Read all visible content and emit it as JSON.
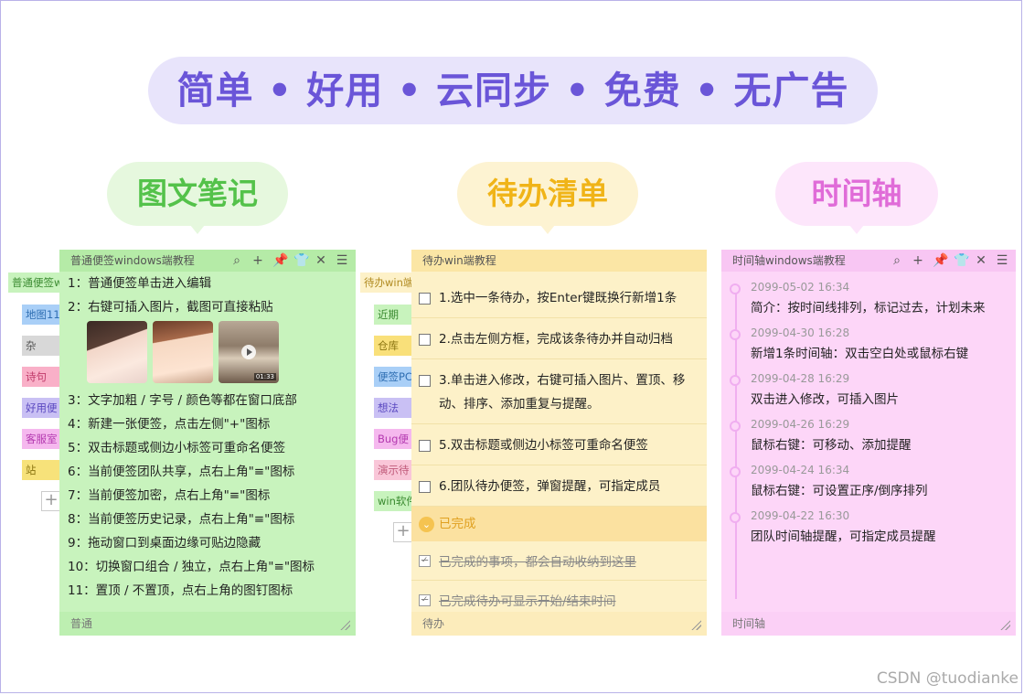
{
  "headline": "简单 • 好用 • 云同步 • 免费 • 无广告",
  "pills": {
    "green": "图文笔记",
    "yellow": "待办清单",
    "pink": "时间轴"
  },
  "green_panel": {
    "title": "普通便签windows端教程",
    "footer": "普通",
    "lines": [
      "1：普通便签单击进入编辑",
      "2：右键可插入图片，截图可直接粘贴",
      "3：文字加粗 / 字号 / 颜色等都在窗口底部",
      "4：新建一张便签，点击左侧\"+\"图标",
      "5：双击标题或侧边小标签可重命名便签",
      "6：当前便签团队共享，点右上角\"≡\"图标",
      "7：当前便签加密，点右上角\"≡\"图标",
      "8：当前便签历史记录，点右上角\"≡\"图标",
      "9：拖动窗口到桌面边缘可贴边隐藏",
      "10：切换窗口组合 / 独立，点右上角\"≡\"图标",
      "11：置顶 / 不置顶，点右上角的图钉图标"
    ],
    "video_duration": "01:33"
  },
  "green_tabs": [
    "普通便签w",
    "地图11",
    "杂",
    "诗句",
    "好用便",
    "客服室",
    "站"
  ],
  "yellow_panel": {
    "title": "待办win端教程",
    "footer": "待办",
    "todos": [
      "1.选中一条待办，按Enter键既换行新增1条",
      "2.点击左侧方框，完成该条待办并自动归档",
      "3.单击进入修改，右键可插入图片、置顶、移动、排序、添加重复与提醒。",
      "5.双击标题或侧边小标签可重命名便签",
      "6.团队待办便签，弹窗提醒，可指定成员"
    ],
    "done_label": "已完成",
    "done_items": [
      "已完成的事项，都会自动收纳到这里",
      "已完成待办可显示开始/结束时间"
    ]
  },
  "yellow_tabs": [
    "待办win端",
    "近期",
    "仓库",
    "便签PC",
    "想法",
    "Bug便",
    "演示待",
    "win软件"
  ],
  "pink_panel": {
    "title": "时间轴windows端教程",
    "footer": "时间轴",
    "events": [
      {
        "date": "2099-05-02 16:34",
        "text": "简介：按时间线排列，标记过去，计划未来"
      },
      {
        "date": "2099-04-30 16:28",
        "text": "新增1条时间轴：双击空白处或鼠标右键"
      },
      {
        "date": "2099-04-28 16:29",
        "text": "双击进入修改，可插入图片"
      },
      {
        "date": "2099-04-26 16:29",
        "text": "鼠标右键：可移动、添加提醒"
      },
      {
        "date": "2099-04-24 16:34",
        "text": "鼠标右键：可设置正序/倒序排列"
      },
      {
        "date": "2099-04-22 16:30",
        "text": "团队时间轴提醒，可指定成员提醒"
      }
    ]
  },
  "icons": [
    "search-icon",
    "plus-icon",
    "pin-icon",
    "shirt-icon",
    "close-icon",
    "menu-icon"
  ],
  "watermark": "CSDN @tuodianke",
  "colors": {
    "accent": "#6a55d8",
    "green": "#54c24a",
    "yellow": "#f0b418",
    "pink": "#e06cd8"
  }
}
